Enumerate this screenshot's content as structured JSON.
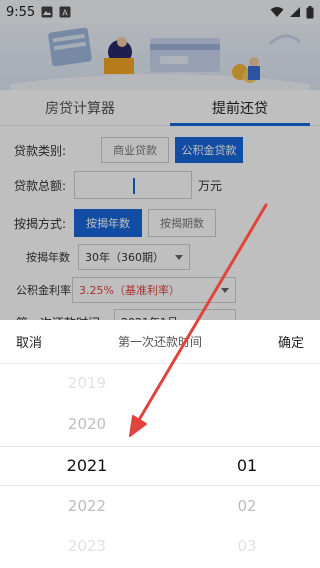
{
  "status_bar": {
    "time": "9:55"
  },
  "tabs": [
    {
      "label": "房贷计算器",
      "active": false
    },
    {
      "label": "提前还贷",
      "active": true
    }
  ],
  "form": {
    "loan_type": {
      "label": "贷款类别:",
      "options": [
        "商业贷款",
        "公积金贷款"
      ],
      "selected": "公积金贷款"
    },
    "total": {
      "label": "贷款总额:",
      "value": "",
      "unit": "万元"
    },
    "method": {
      "label": "按揭方式:",
      "options": [
        "按揭年数",
        "按揭期数"
      ],
      "selected": "按揭年数"
    },
    "years": {
      "label": "按揭年数",
      "value": "30年（360期）"
    },
    "rate": {
      "label": "公积金利率",
      "value": "3.25%（基准利率）"
    },
    "first_payment": {
      "label": "第一次还款时间:",
      "value": "2021年1月"
    }
  },
  "picker": {
    "cancel": "取消",
    "title": "第一次还款时间",
    "confirm": "确定",
    "years": [
      "2019",
      "2020",
      "2021",
      "2022",
      "2023"
    ],
    "selected_year": "2021",
    "months": [
      "",
      "",
      "01",
      "02",
      "03"
    ],
    "selected_month": "01"
  },
  "colors": {
    "accent": "#1767d9",
    "arrow": "#e0443c",
    "rate_text": "#e0443c"
  }
}
